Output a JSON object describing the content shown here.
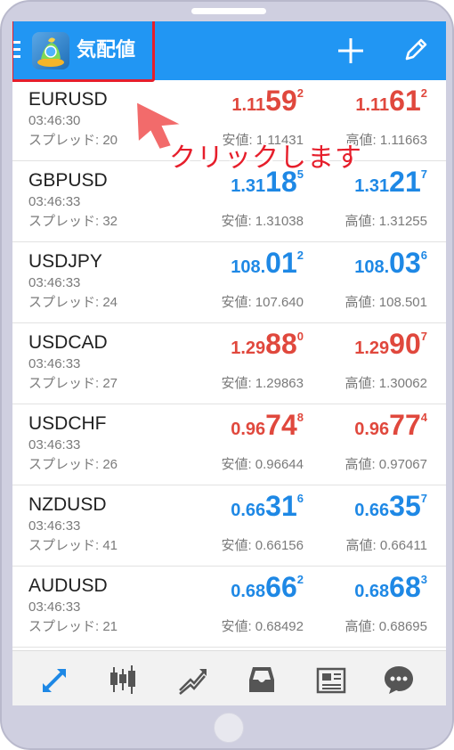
{
  "header": {
    "title": "気配値",
    "menu_icon": "hamburger-menu-icon",
    "add_icon": "plus-icon",
    "edit_icon": "pencil-icon"
  },
  "annotation": {
    "text": "クリックします",
    "color": "#e61e2b"
  },
  "colors": {
    "accent": "#2196f3",
    "price_up": "#1e88e5",
    "price_down": "#e0483d"
  },
  "quotes": [
    {
      "symbol": "EURUSD",
      "time": "03:46:30",
      "spread": "スプレッド: 20",
      "bid": {
        "small": "1.11",
        "big": "59",
        "pip": "2"
      },
      "ask": {
        "small": "1.11",
        "big": "61",
        "pip": "2"
      },
      "low": "安値: 1.11431",
      "high": "高値: 1.11663",
      "direction": "down"
    },
    {
      "symbol": "GBPUSD",
      "time": "03:46:33",
      "spread": "スプレッド: 32",
      "bid": {
        "small": "1.31",
        "big": "18",
        "pip": "5"
      },
      "ask": {
        "small": "1.31",
        "big": "21",
        "pip": "7"
      },
      "low": "安値: 1.31038",
      "high": "高値: 1.31255",
      "direction": "up"
    },
    {
      "symbol": "USDJPY",
      "time": "03:46:33",
      "spread": "スプレッド: 24",
      "bid": {
        "small": "108.",
        "big": "01",
        "pip": "2"
      },
      "ask": {
        "small": "108.",
        "big": "03",
        "pip": "6"
      },
      "low": "安値: 107.640",
      "high": "高値: 108.501",
      "direction": "up"
    },
    {
      "symbol": "USDCAD",
      "time": "03:46:33",
      "spread": "スプレッド: 27",
      "bid": {
        "small": "1.29",
        "big": "88",
        "pip": "0"
      },
      "ask": {
        "small": "1.29",
        "big": "90",
        "pip": "7"
      },
      "low": "安値: 1.29863",
      "high": "高値: 1.30062",
      "direction": "down"
    },
    {
      "symbol": "USDCHF",
      "time": "03:46:33",
      "spread": "スプレッド: 26",
      "bid": {
        "small": "0.96",
        "big": "74",
        "pip": "8"
      },
      "ask": {
        "small": "0.96",
        "big": "77",
        "pip": "4"
      },
      "low": "安値: 0.96644",
      "high": "高値: 0.97067",
      "direction": "down"
    },
    {
      "symbol": "NZDUSD",
      "time": "03:46:33",
      "spread": "スプレッド: 41",
      "bid": {
        "small": "0.66",
        "big": "31",
        "pip": "6"
      },
      "ask": {
        "small": "0.66",
        "big": "35",
        "pip": "7"
      },
      "low": "安値: 0.66156",
      "high": "高値: 0.66411",
      "direction": "up"
    },
    {
      "symbol": "AUDUSD",
      "time": "03:46:33",
      "spread": "スプレッド: 21",
      "bid": {
        "small": "0.68",
        "big": "66",
        "pip": "2"
      },
      "ask": {
        "small": "0.68",
        "big": "68",
        "pip": "3"
      },
      "low": "安値: 0.68492",
      "high": "高値: 0.68695",
      "direction": "up"
    }
  ],
  "bottom_nav": [
    {
      "icon": "quotes-arrows-icon",
      "active": true
    },
    {
      "icon": "candlestick-chart-icon",
      "active": false
    },
    {
      "icon": "trade-chart-icon",
      "active": false
    },
    {
      "icon": "inbox-icon",
      "active": false
    },
    {
      "icon": "news-icon",
      "active": false
    },
    {
      "icon": "chat-bubble-icon",
      "active": false
    }
  ]
}
